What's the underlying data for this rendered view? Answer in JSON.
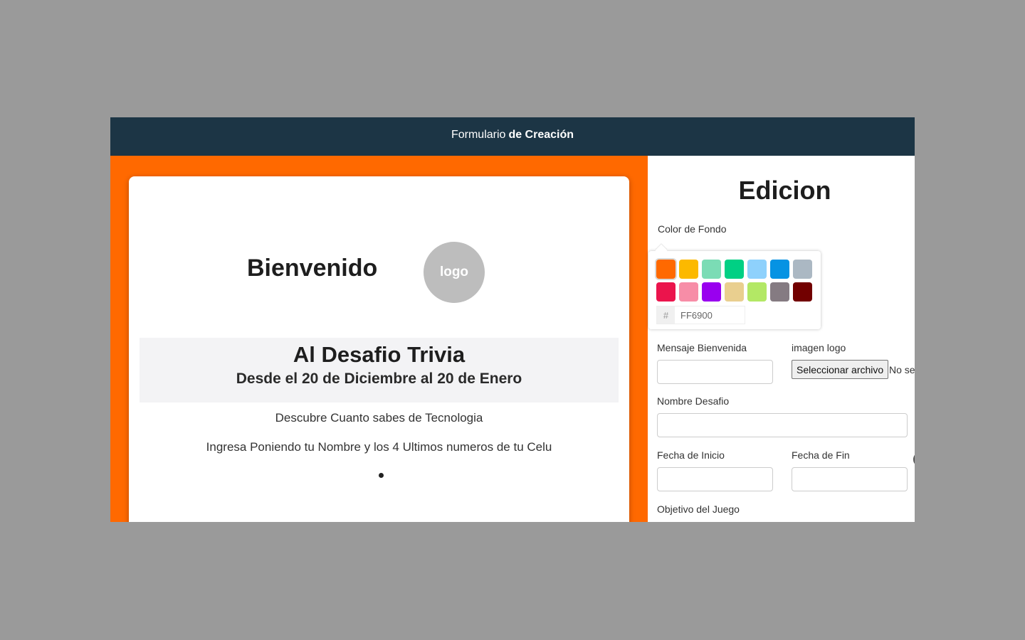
{
  "header": {
    "title_light": "Formulario",
    "title_bold": "de Creación"
  },
  "preview": {
    "welcome": "Bienvenido",
    "logo_text": "logo",
    "banner_title": "Al Desafio Trivia",
    "banner_subtitle": "Desde el 20 de Diciembre al 20 de Enero",
    "description1": "Descubre Cuanto sabes de Tecnologia",
    "description2": "Ingresa Poniendo tu Nombre y los 4 Ultimos numeros de tu Celu",
    "background_color": "#FF6900"
  },
  "editor": {
    "title": "Edicion",
    "color_label": "Color de Fondo",
    "swatches": [
      "#FF6900",
      "#FCB900",
      "#7BDCB5",
      "#00D084",
      "#8ED1FC",
      "#0693E3",
      "#ABB8C3",
      "#EB144C",
      "#F78DA7",
      "#9900EF",
      "#E9CF8F",
      "#B3E865",
      "#857B82",
      "#720000"
    ],
    "hex_prefix": "#",
    "hex_value": "FF6900",
    "welcome_msg_label": "Mensaje Bienvenida",
    "logo_label": "imagen logo",
    "file_button": "Seleccionar archivo",
    "file_status": "No se",
    "challenge_name_label": "Nombre Desafio",
    "start_date_label": "Fecha de Inicio",
    "end_date_label": "Fecha de Fin",
    "objective_label": "Objetivo del Juego"
  }
}
